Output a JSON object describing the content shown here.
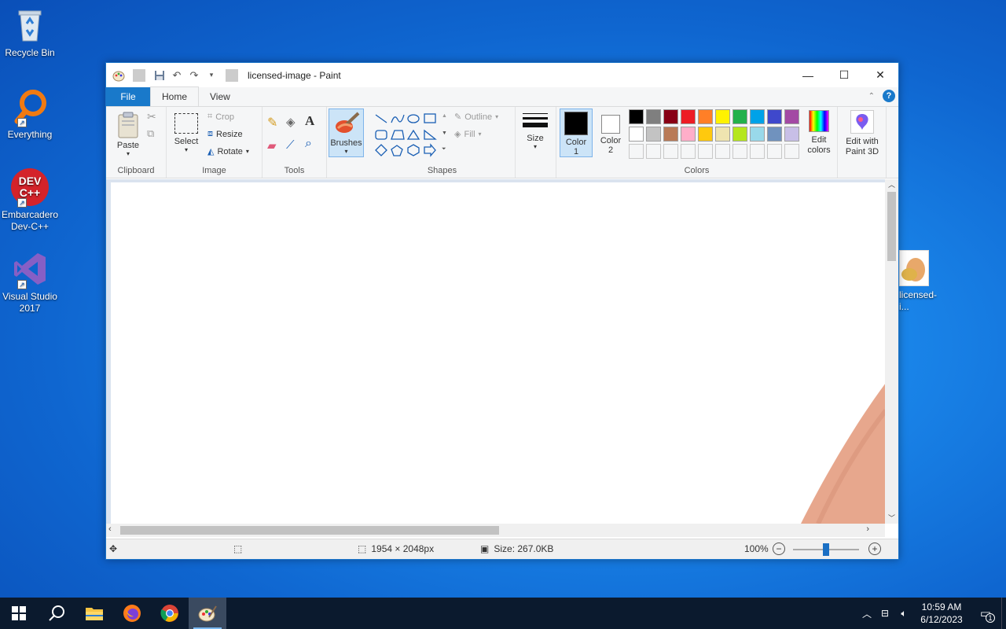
{
  "desktop": {
    "icons": [
      {
        "label": "Recycle Bin"
      },
      {
        "label": "Everything"
      },
      {
        "label": "Embarcadero Dev-C++"
      },
      {
        "label": "Visual Studio 2017"
      },
      {
        "label": "licensed-i..."
      }
    ],
    "devcpp_logo_text": "DEV C++"
  },
  "window": {
    "title": "licensed-image - Paint",
    "tabs": {
      "file": "File",
      "home": "Home",
      "view": "View"
    },
    "help": "?",
    "ribbon": {
      "clipboard": {
        "paste": "Paste",
        "label": "Clipboard"
      },
      "image": {
        "select": "Select",
        "crop": "Crop",
        "resize": "Resize",
        "rotate": "Rotate",
        "label": "Image"
      },
      "tools": {
        "label": "Tools",
        "text_tool": "A"
      },
      "brushes": "Brushes",
      "shapes": {
        "outline": "Outline",
        "fill": "Fill",
        "label": "Shapes"
      },
      "size": "Size",
      "color1": {
        "line1": "Color",
        "line2": "1"
      },
      "color2": {
        "line1": "Color",
        "line2": "2"
      },
      "colors_label": "Colors",
      "edit_colors": {
        "line1": "Edit",
        "line2": "colors"
      },
      "edit_3d": {
        "line1": "Edit with",
        "line2": "Paint 3D"
      },
      "palette_row1": [
        "#000000",
        "#7f7f7f",
        "#880015",
        "#ed1c24",
        "#ff7f27",
        "#fff200",
        "#22b14c",
        "#00a2e8",
        "#3f48cc",
        "#a349a4"
      ],
      "palette_row2": [
        "#ffffff",
        "#c3c3c3",
        "#b97a57",
        "#ffaec9",
        "#ffc90e",
        "#efe4b0",
        "#b5e61d",
        "#99d9ea",
        "#7092be",
        "#c8bfe7"
      ],
      "color1_value": "#000000",
      "color2_value": "#ffffff"
    },
    "status": {
      "dimensions": "1954 × 2048px",
      "size": "Size: 267.0KB",
      "zoom": "100%",
      "zoom_level": 0.5
    }
  },
  "taskbar": {
    "time": "10:59 AM",
    "date": "6/12/2023",
    "notifications": "1"
  }
}
